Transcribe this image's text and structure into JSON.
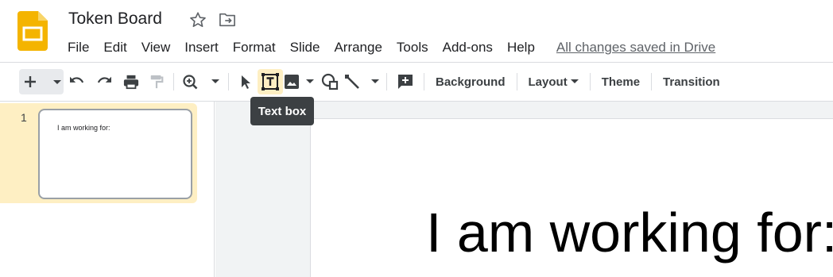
{
  "app": {
    "title": "Token Board",
    "status": "All changes saved in Drive",
    "brand_color": "#f4b400"
  },
  "menu": {
    "items": [
      "File",
      "Edit",
      "View",
      "Insert",
      "Format",
      "Slide",
      "Arrange",
      "Tools",
      "Add-ons",
      "Help"
    ]
  },
  "toolbar": {
    "background_label": "Background",
    "layout_label": "Layout",
    "theme_label": "Theme",
    "transition_label": "Transition",
    "icons": [
      "new-slide-icon",
      "undo-icon",
      "redo-icon",
      "print-icon",
      "paint-format-icon",
      "zoom-icon",
      "select-icon",
      "text-box-icon",
      "image-icon",
      "shape-icon",
      "line-icon",
      "comment-icon"
    ],
    "active_tool": "text-box-icon"
  },
  "tooltip": {
    "text": "Text box"
  },
  "filmstrip": {
    "slides": [
      {
        "number": "1",
        "text": "I am working for:"
      }
    ]
  },
  "slide": {
    "text": "I am working for:"
  }
}
